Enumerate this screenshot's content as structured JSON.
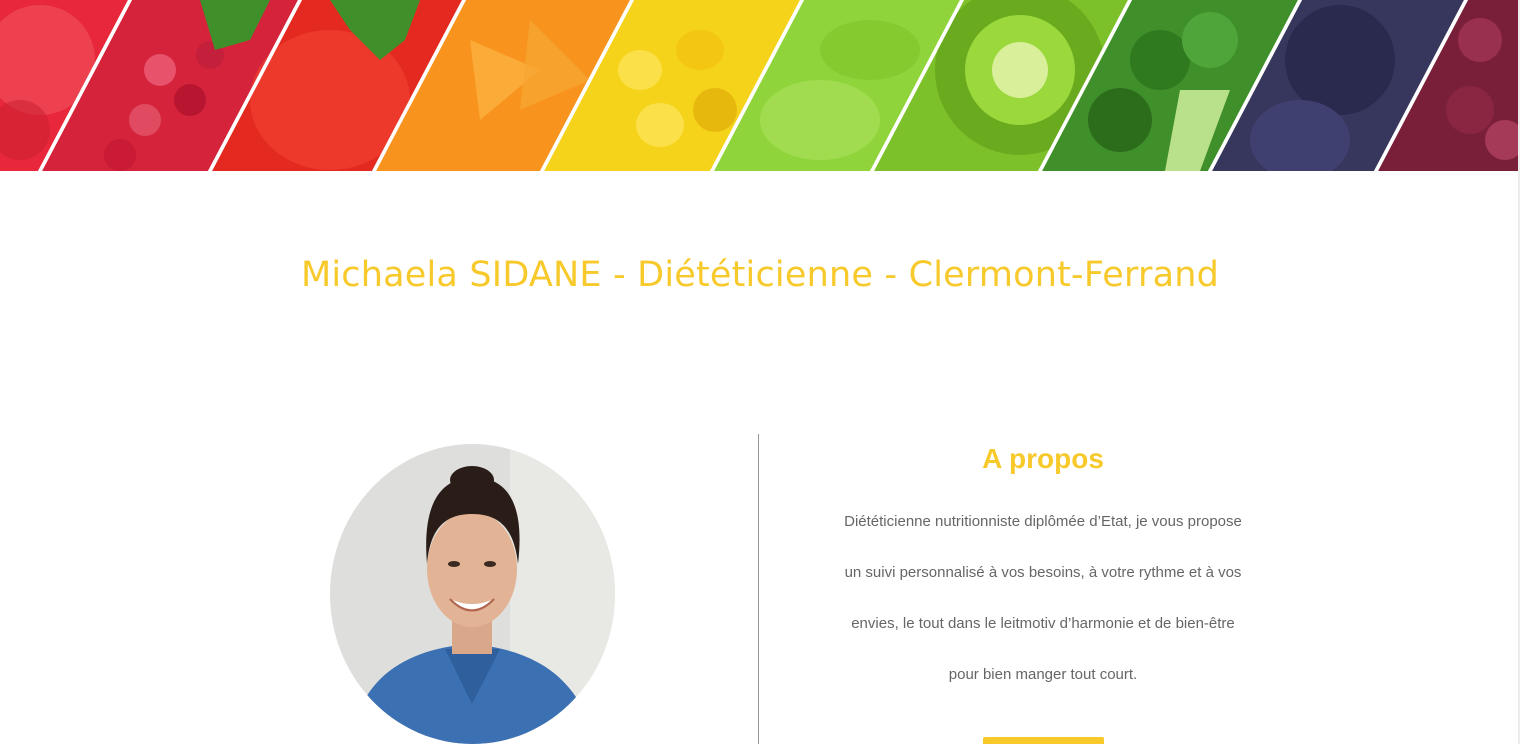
{
  "banner": {
    "image_alt": "fruits and vegetables banner",
    "stripes": [
      {
        "name": "grapefruit",
        "color": "#e8283a"
      },
      {
        "name": "raspberry",
        "color": "#d4233a"
      },
      {
        "name": "tomato",
        "color": "#e42a20"
      },
      {
        "name": "orange",
        "color": "#f8941d"
      },
      {
        "name": "corn",
        "color": "#f5d31b"
      },
      {
        "name": "lettuce",
        "color": "#8fd43a"
      },
      {
        "name": "kiwi",
        "color": "#7cc12a"
      },
      {
        "name": "broccoli",
        "color": "#3f8f2a"
      },
      {
        "name": "plum",
        "color": "#37375e"
      },
      {
        "name": "grape",
        "color": "#7a1f3a"
      }
    ]
  },
  "header": {
    "title": "Michaela SIDANE - Diététicienne - Clermont-Ferrand"
  },
  "about": {
    "heading": "A propos",
    "lines": [
      "Diététicienne nutritionniste diplômée d’Etat, je vous propose",
      "un suivi personnalisé à vos besoins, à votre rythme et à vos",
      "envies, le tout dans le leitmotiv d’harmonie et de bien-être",
      "pour bien manger tout court."
    ],
    "button_label": ""
  },
  "portrait": {
    "alt": "portrait photo"
  },
  "colors": {
    "accent": "#f7c92b",
    "body_text": "#666666",
    "divider": "#999999"
  }
}
